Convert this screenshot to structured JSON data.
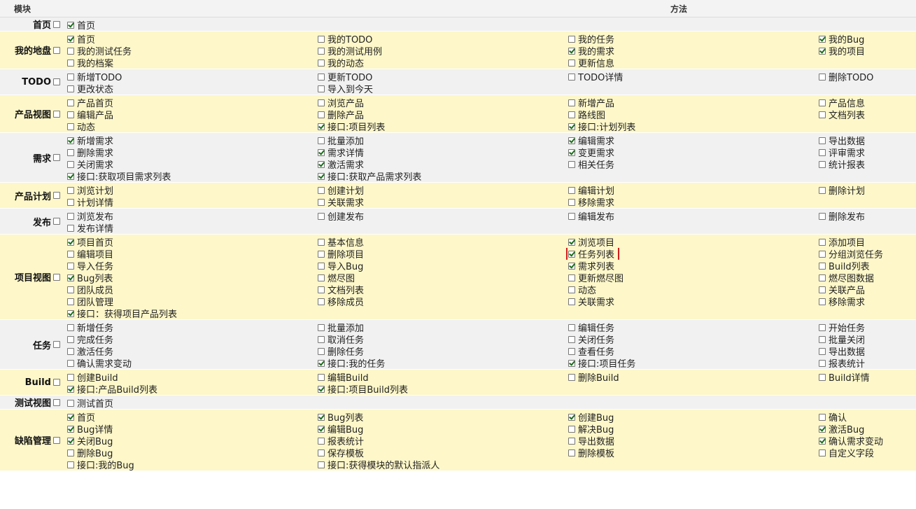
{
  "header": {
    "module": "模块",
    "method": "方法"
  },
  "modules": [
    {
      "name": "首页",
      "checked": false,
      "items": [
        {
          "label": "首页",
          "checked": true
        }
      ]
    },
    {
      "name": "我的地盘",
      "checked": false,
      "items": [
        {
          "label": "首页",
          "checked": true
        },
        {
          "label": "我的TODO",
          "checked": false
        },
        {
          "label": "我的任务",
          "checked": false
        },
        {
          "label": "我的Bug",
          "checked": true
        },
        {
          "label": "我的测试任务",
          "checked": false
        },
        {
          "label": "我的测试用例",
          "checked": false
        },
        {
          "label": "我的需求",
          "checked": true
        },
        {
          "label": "我的项目",
          "checked": true
        },
        {
          "label": "我的档案",
          "checked": false
        },
        {
          "label": "我的动态",
          "checked": false
        },
        {
          "label": "更新信息",
          "checked": false
        }
      ]
    },
    {
      "name": "TODO",
      "checked": false,
      "items": [
        {
          "label": "新增TODO",
          "checked": false
        },
        {
          "label": "更新TODO",
          "checked": false
        },
        {
          "label": "TODO详情",
          "checked": false
        },
        {
          "label": "删除TODO",
          "checked": false
        },
        {
          "label": "更改状态",
          "checked": false
        },
        {
          "label": "导入到今天",
          "checked": false
        }
      ]
    },
    {
      "name": "产品视图",
      "checked": false,
      "items": [
        {
          "label": "产品首页",
          "checked": false
        },
        {
          "label": "浏览产品",
          "checked": false
        },
        {
          "label": "新增产品",
          "checked": false
        },
        {
          "label": "产品信息",
          "checked": false
        },
        {
          "label": "编辑产品",
          "checked": false
        },
        {
          "label": "删除产品",
          "checked": false
        },
        {
          "label": "路线图",
          "checked": false
        },
        {
          "label": "文档列表",
          "checked": false
        },
        {
          "label": "动态",
          "checked": false
        },
        {
          "label": "接口:项目列表",
          "checked": true
        },
        {
          "label": "接口:计划列表",
          "checked": true
        }
      ]
    },
    {
      "name": "需求",
      "checked": false,
      "items": [
        {
          "label": "新增需求",
          "checked": true
        },
        {
          "label": "批量添加",
          "checked": false
        },
        {
          "label": "编辑需求",
          "checked": true
        },
        {
          "label": "导出数据",
          "checked": false
        },
        {
          "label": "删除需求",
          "checked": false
        },
        {
          "label": "需求详情",
          "checked": true
        },
        {
          "label": "变更需求",
          "checked": true
        },
        {
          "label": "评审需求",
          "checked": false
        },
        {
          "label": "关闭需求",
          "checked": false
        },
        {
          "label": "激活需求",
          "checked": true
        },
        {
          "label": "相关任务",
          "checked": false
        },
        {
          "label": "统计报表",
          "checked": false
        },
        {
          "label": "接口:获取项目需求列表",
          "checked": true
        },
        {
          "label": "接口:获取产品需求列表",
          "checked": true
        }
      ]
    },
    {
      "name": "产品计划",
      "checked": false,
      "items": [
        {
          "label": "浏览计划",
          "checked": false
        },
        {
          "label": "创建计划",
          "checked": false
        },
        {
          "label": "编辑计划",
          "checked": false
        },
        {
          "label": "删除计划",
          "checked": false
        },
        {
          "label": "计划详情",
          "checked": false
        },
        {
          "label": "关联需求",
          "checked": false
        },
        {
          "label": "移除需求",
          "checked": false
        }
      ]
    },
    {
      "name": "发布",
      "checked": false,
      "items": [
        {
          "label": "浏览发布",
          "checked": false
        },
        {
          "label": "创建发布",
          "checked": false
        },
        {
          "label": "编辑发布",
          "checked": false
        },
        {
          "label": "删除发布",
          "checked": false
        },
        {
          "label": "发布详情",
          "checked": false
        }
      ]
    },
    {
      "name": "项目视图",
      "checked": false,
      "items": [
        {
          "label": "项目首页",
          "checked": true
        },
        {
          "label": "基本信息",
          "checked": false
        },
        {
          "label": "浏览项目",
          "checked": true
        },
        {
          "label": "添加项目",
          "checked": false
        },
        {
          "label": "编辑项目",
          "checked": false
        },
        {
          "label": "删除项目",
          "checked": false
        },
        {
          "label": "任务列表",
          "checked": true,
          "highlight": true
        },
        {
          "label": "分组浏览任务",
          "checked": false
        },
        {
          "label": "导入任务",
          "checked": false
        },
        {
          "label": "导入Bug",
          "checked": false
        },
        {
          "label": "需求列表",
          "checked": true
        },
        {
          "label": "Build列表",
          "checked": false
        },
        {
          "label": "Bug列表",
          "checked": true
        },
        {
          "label": "燃尽图",
          "checked": false
        },
        {
          "label": "更新燃尽图",
          "checked": false
        },
        {
          "label": "燃尽图数据",
          "checked": false
        },
        {
          "label": "团队成员",
          "checked": false
        },
        {
          "label": "文档列表",
          "checked": false
        },
        {
          "label": "动态",
          "checked": false
        },
        {
          "label": "关联产品",
          "checked": false
        },
        {
          "label": "团队管理",
          "checked": false
        },
        {
          "label": "移除成员",
          "checked": false
        },
        {
          "label": "关联需求",
          "checked": false
        },
        {
          "label": "移除需求",
          "checked": false
        },
        {
          "label": "接口：获得项目产品列表",
          "checked": true
        }
      ]
    },
    {
      "name": "任务",
      "checked": false,
      "items": [
        {
          "label": "新增任务",
          "checked": false
        },
        {
          "label": "批量添加",
          "checked": false
        },
        {
          "label": "编辑任务",
          "checked": false
        },
        {
          "label": "开始任务",
          "checked": false
        },
        {
          "label": "完成任务",
          "checked": false
        },
        {
          "label": "取消任务",
          "checked": false
        },
        {
          "label": "关闭任务",
          "checked": false
        },
        {
          "label": "批量关闭",
          "checked": false
        },
        {
          "label": "激活任务",
          "checked": false
        },
        {
          "label": "删除任务",
          "checked": false
        },
        {
          "label": "查看任务",
          "checked": false
        },
        {
          "label": "导出数据",
          "checked": false
        },
        {
          "label": "确认需求变动",
          "checked": false
        },
        {
          "label": "接口:我的任务",
          "checked": true
        },
        {
          "label": "接口:项目任务",
          "checked": true
        },
        {
          "label": "报表统计",
          "checked": false
        }
      ]
    },
    {
      "name": "Build",
      "checked": false,
      "items": [
        {
          "label": "创建Build",
          "checked": false
        },
        {
          "label": "编辑Build",
          "checked": false
        },
        {
          "label": "删除Build",
          "checked": false
        },
        {
          "label": "Build详情",
          "checked": false
        },
        {
          "label": "接口:产品Build列表",
          "checked": true
        },
        {
          "label": "接口:项目Build列表",
          "checked": true
        }
      ]
    },
    {
      "name": "测试视图",
      "checked": false,
      "items": [
        {
          "label": "测试首页",
          "checked": false
        }
      ]
    },
    {
      "name": "缺陷管理",
      "checked": false,
      "items": [
        {
          "label": "首页",
          "checked": true
        },
        {
          "label": "Bug列表",
          "checked": true
        },
        {
          "label": "创建Bug",
          "checked": true
        },
        {
          "label": "确认",
          "checked": false
        },
        {
          "label": "Bug详情",
          "checked": true
        },
        {
          "label": "编辑Bug",
          "checked": true
        },
        {
          "label": "解决Bug",
          "checked": false
        },
        {
          "label": "激活Bug",
          "checked": true
        },
        {
          "label": "关闭Bug",
          "checked": true
        },
        {
          "label": "报表统计",
          "checked": false
        },
        {
          "label": "导出数据",
          "checked": false
        },
        {
          "label": "确认需求变动",
          "checked": true
        },
        {
          "label": "删除Bug",
          "checked": false
        },
        {
          "label": "保存模板",
          "checked": false
        },
        {
          "label": "删除模板",
          "checked": false
        },
        {
          "label": "自定义字段",
          "checked": false
        },
        {
          "label": "接口:我的Bug",
          "checked": false
        },
        {
          "label": "接口:获得模块的默认指派人",
          "checked": false
        }
      ]
    }
  ]
}
